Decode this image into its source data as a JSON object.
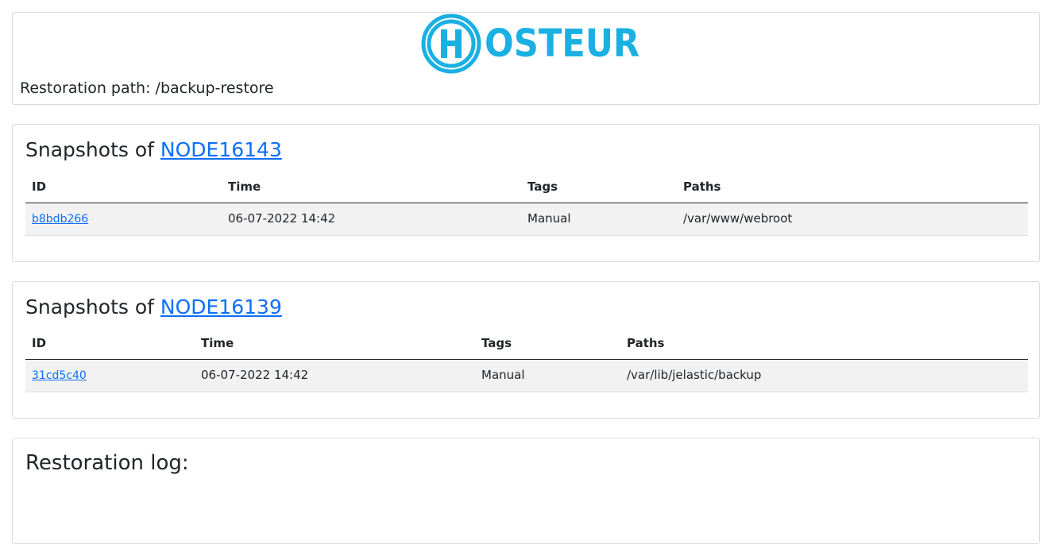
{
  "header": {
    "logo_text": "OSTEUR",
    "logo_color": "#1ab0e2",
    "restoration_path": "Restoration path: /backup-restore"
  },
  "snapshots": [
    {
      "title_prefix": "Snapshots of ",
      "node": "NODE16143",
      "columns": [
        "ID",
        "Time",
        "Tags",
        "Paths"
      ],
      "rows": [
        {
          "id": "b8bdb266",
          "time": "06-07-2022 14:42",
          "tags": "Manual",
          "paths": "/var/www/webroot"
        }
      ]
    },
    {
      "title_prefix": "Snapshots of ",
      "node": "NODE16139",
      "columns": [
        "ID",
        "Time",
        "Tags",
        "Paths"
      ],
      "rows": [
        {
          "id": "31cd5c40",
          "time": "06-07-2022 14:42",
          "tags": "Manual",
          "paths": "/var/lib/jelastic/backup"
        }
      ]
    }
  ],
  "log": {
    "title": "Restoration log:"
  },
  "colors": {
    "link": "#0d6efd",
    "row_bg": "#f2f2f2",
    "border": "#d9dde2"
  }
}
